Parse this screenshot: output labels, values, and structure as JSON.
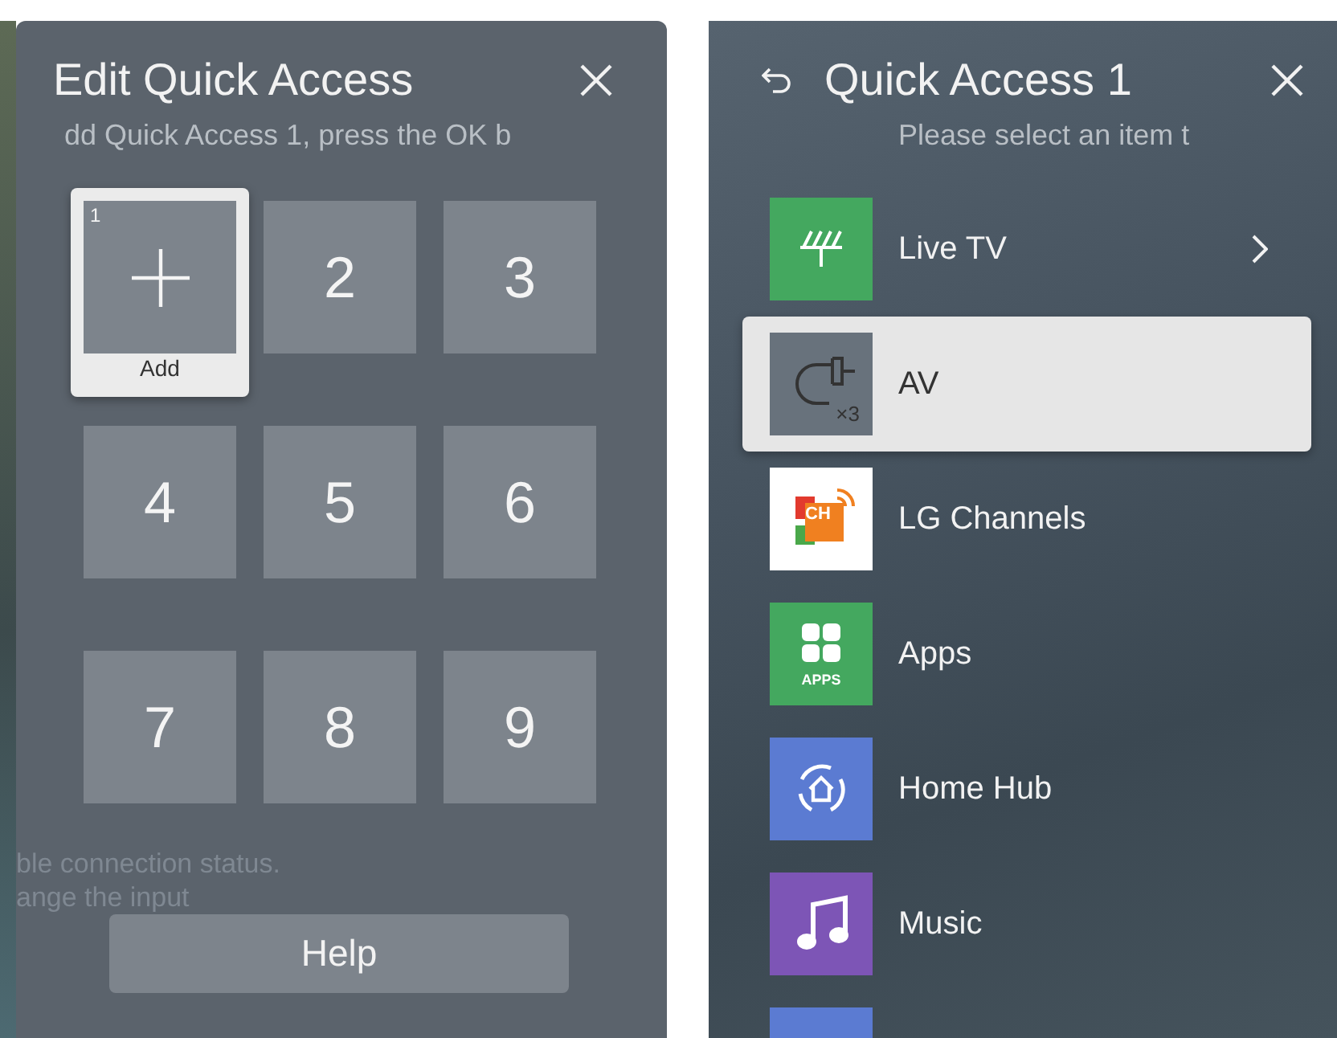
{
  "edit_panel": {
    "title": "Edit Quick Access",
    "subtitle": "dd Quick Access 1, press the OK b",
    "tiles": [
      {
        "number": "1",
        "label": "Add",
        "selected": true
      },
      {
        "number": "2",
        "selected": false
      },
      {
        "number": "3",
        "selected": false
      },
      {
        "number": "4",
        "selected": false
      },
      {
        "number": "5",
        "selected": false
      },
      {
        "number": "6",
        "selected": false
      },
      {
        "number": "7",
        "selected": false
      },
      {
        "number": "8",
        "selected": false
      },
      {
        "number": "9",
        "selected": false
      }
    ],
    "background_texts": [
      "ble connection status.",
      "ange the input"
    ],
    "help_button": "Help"
  },
  "select_panel": {
    "title": "Quick Access 1",
    "subtitle": "Please select an item t",
    "items": [
      {
        "kind": "antenna",
        "label": "Live TV",
        "color": "#44a85f",
        "has_submenu": true,
        "selected": false
      },
      {
        "kind": "cable",
        "label": "AV",
        "icon_text": "×3",
        "color": "#68727c",
        "has_submenu": false,
        "selected": true
      },
      {
        "kind": "channels",
        "label": "LG Channels",
        "icon_text": "CH",
        "color": "#ffffff",
        "has_submenu": false,
        "selected": false
      },
      {
        "kind": "apps",
        "label": "Apps",
        "icon_text": "APPS",
        "color": "#44a85f",
        "has_submenu": false,
        "selected": false
      },
      {
        "kind": "homehub",
        "label": "Home Hub",
        "color": "#5b7bd2",
        "has_submenu": false,
        "selected": false
      },
      {
        "kind": "music",
        "label": "Music",
        "color": "#7d55b6",
        "has_submenu": false,
        "selected": false
      },
      {
        "kind": "partial",
        "color": "#5b7bd2",
        "has_submenu": false,
        "selected": false
      }
    ]
  }
}
